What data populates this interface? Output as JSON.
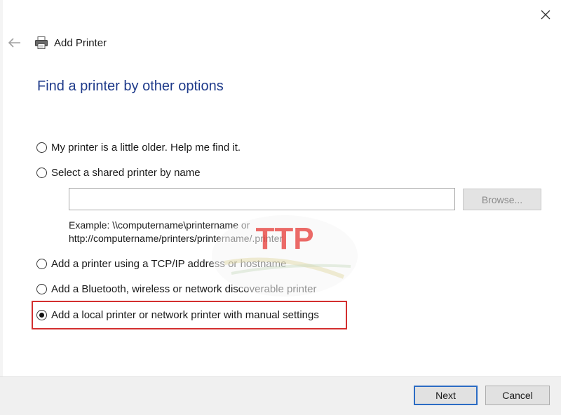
{
  "header": {
    "title": "Add Printer",
    "close_icon": "close-icon",
    "back_icon": "back-arrow-icon",
    "printer_icon": "printer-icon"
  },
  "heading": "Find a printer by other options",
  "options": [
    {
      "label": "My printer is a little older. Help me find it.",
      "checked": false
    },
    {
      "label": "Select a shared printer by name",
      "checked": false
    },
    {
      "label": "Add a printer using a TCP/IP address or hostname",
      "checked": false
    },
    {
      "label": "Add a Bluetooth, wireless or network discoverable printer",
      "checked": false
    },
    {
      "label": "Add a local printer or network printer with manual settings",
      "checked": true
    }
  ],
  "shared_printer": {
    "value": "",
    "browse_label": "Browse...",
    "example_line1": "Example: \\\\computername\\printername or",
    "example_line2": "http://computername/printers/printername/.printer"
  },
  "watermark": {
    "text": "TTP"
  },
  "footer": {
    "next_label": "Next",
    "cancel_label": "Cancel"
  },
  "colors": {
    "heading": "#1e3a8a",
    "highlight": "#d32f2f",
    "next_border": "#2c6cc4",
    "watermark_red": "#e53935"
  }
}
